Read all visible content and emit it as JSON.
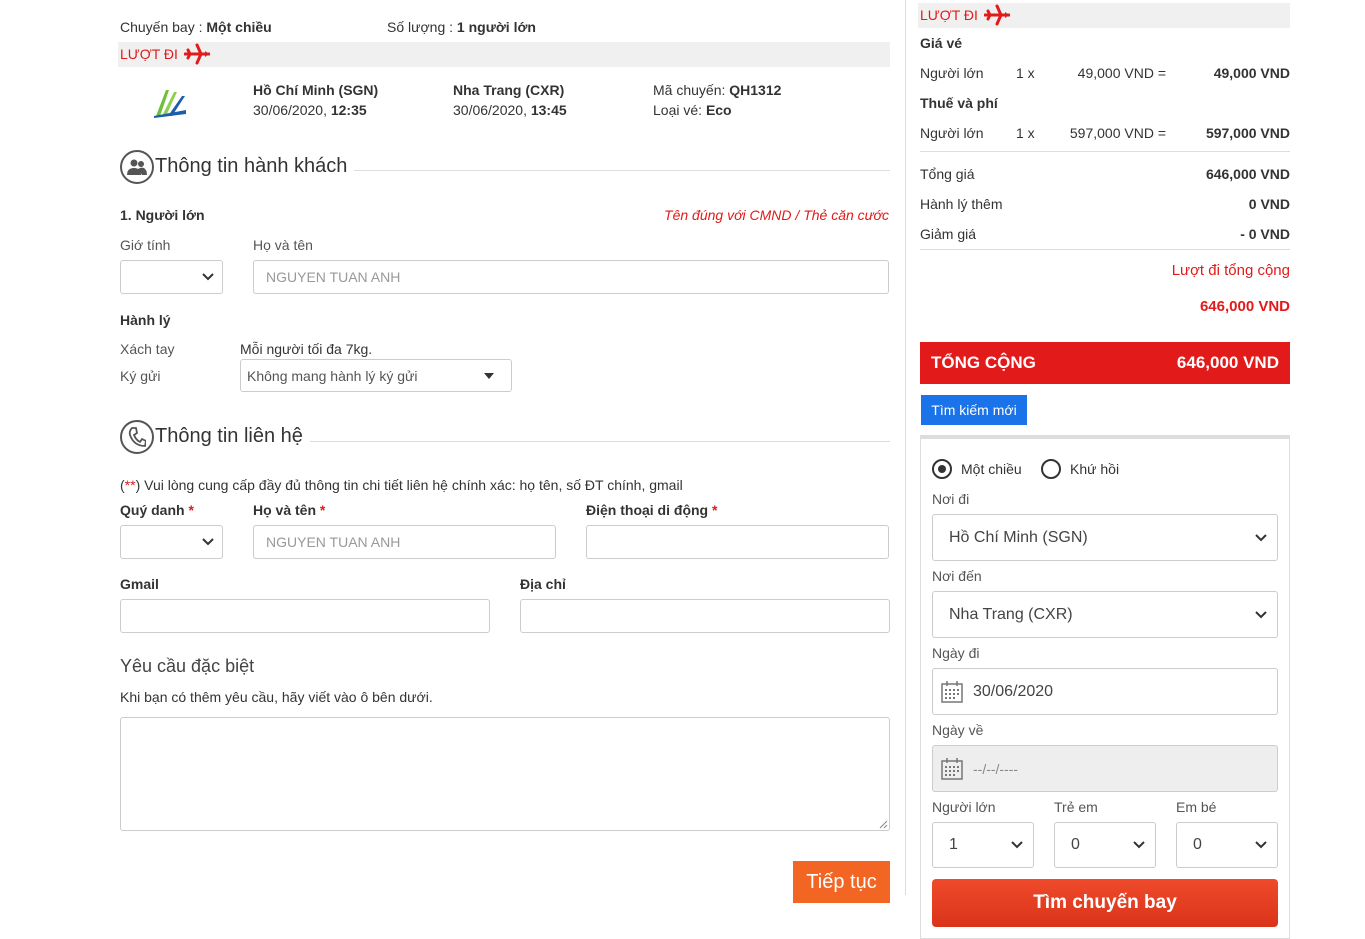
{
  "summary": {
    "trip_label": "Chuyến bay : ",
    "trip_value": "Một chiều",
    "qty_label": "Số lượng : ",
    "qty_value": "1 người lớn",
    "outbound_label": "LƯỢT ĐI"
  },
  "flight": {
    "from_city": "Hồ Chí Minh (SGN)",
    "from_date": "30/06/2020, ",
    "from_time": "12:35",
    "to_city": "Nha Trang (CXR)",
    "to_date": "30/06/2020, ",
    "to_time": "13:45",
    "code_label": "Mã chuyến: ",
    "code_value": "QH1312",
    "class_label": "Loại vé: ",
    "class_value": "Eco"
  },
  "passenger": {
    "section_title": "Thông tin hành khách",
    "item_title": "1. Người lớn",
    "id_note": "Tên đúng với CMND / Thẻ căn cước",
    "gender_label": "Giớ tính",
    "name_label": "Họ và tên",
    "name_placeholder": "NGUYEN TUAN ANH",
    "baggage_title": "Hành lý",
    "carry_label": "Xách tay",
    "carry_value": "Mỗi người tối đa 7kg.",
    "checked_label": "Ký gửi",
    "checked_value": "Không mang hành lý ký gửi"
  },
  "contact": {
    "section_title": "Thông tin liên hệ",
    "note_prefix": "(",
    "note_stars": "**",
    "note_text": ") Vui lòng cung cấp đầy đủ thông tin chi tiết liên hệ chính xác: họ tên, số ĐT chính, gmail",
    "title_label": "Quý danh",
    "name_label": "Họ và tên",
    "name_placeholder": "NGUYEN TUAN ANH",
    "phone_label": "Điện thoại di động",
    "required_mark": "*",
    "gmail_label": "Gmail",
    "address_label": "Địa chỉ"
  },
  "special": {
    "title": "Yêu cầu đặc biệt",
    "hint": "Khi bạn có thêm yêu cầu, hãy viết vào ô bên dưới."
  },
  "continue_label": "Tiếp tục",
  "price": {
    "outbound_label": "LƯỢT ĐI",
    "fare_title": "Giá vé",
    "fare_row": {
      "type": "Người lớn",
      "qty": "1 x",
      "unit": "49,000 VND =",
      "total": "49,000 VND"
    },
    "tax_title": "Thuế và phí",
    "tax_row": {
      "type": "Người lớn",
      "qty": "1 x",
      "unit": "597,000 VND =",
      "total": "597,000 VND"
    },
    "total_label": "Tổng giá",
    "total_value": "646,000 VND",
    "baggage_label": "Hành lý thêm",
    "baggage_value": "0 VND",
    "discount_label": "Giảm giá",
    "discount_value": "- 0 VND",
    "outbound_total_label": "Lượt đi tổng cộng",
    "outbound_total_value": "646,000 VND",
    "grand_label": "TỔNG CỘNG",
    "grand_value": "646,000 VND"
  },
  "search": {
    "new_search_label": "Tìm kiếm mới",
    "oneway_label": "Một chiều",
    "roundtrip_label": "Khứ hồi",
    "from_label": "Nơi đi",
    "from_value": "Hồ Chí Minh (SGN)",
    "to_label": "Nơi đến",
    "to_value": "Nha Trang (CXR)",
    "depart_label": "Ngày đi",
    "depart_value": "30/06/2020",
    "return_label": "Ngày về",
    "return_placeholder": "--/--/----",
    "adult_label": "Người lớn",
    "adult_value": "1",
    "child_label": "Trẻ em",
    "child_value": "0",
    "infant_label": "Em bé",
    "infant_value": "0",
    "submit_label": "Tìm chuyến bay"
  },
  "colors": {
    "accent_red": "#e21a1a",
    "orange": "#f26522",
    "blue": "#1a73e8"
  }
}
